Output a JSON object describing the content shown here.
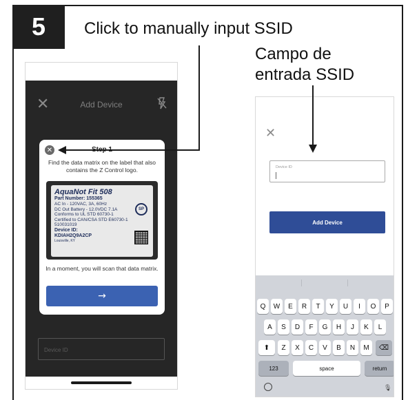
{
  "step_number": "5",
  "top_caption": "Click to manually input SSID",
  "right_caption": {
    "line1": "Campo de",
    "line2": "entrada SSID"
  },
  "left_phone": {
    "header_title": "Add Device",
    "close_glyph": "✕",
    "flash_icon": "flash-off-icon",
    "modal": {
      "close_glyph": "✕",
      "title": "Step 1",
      "instruction": "Find the data matrix on the label that also contains the Z Control logo.",
      "label": {
        "brand": "AquaNot Fit 508",
        "part_number": "Part Number: 155365",
        "line1": "AC In - 120VAC, 3A, 60Hz",
        "line2": "DC Out Battery - 12.0VDC 7.1A",
        "line3": "Conforms to UL STD 60730-1",
        "line4": "Certified to CAN/CSA STD E60730-1",
        "line5": "510031019",
        "device_id_label": "Device ID:",
        "device_id": "KDIAH2Q9A2CP",
        "location": "Louisville, KY",
        "csa": "SP"
      },
      "note": "In a moment, you will scan that data matrix.",
      "next_glyph": "→"
    },
    "field_placeholder": "Device ID"
  },
  "right_phone": {
    "close_glyph": "✕",
    "field_label": "Device ID",
    "button_label": "Add Device",
    "keyboard": {
      "row1": [
        "Q",
        "W",
        "E",
        "R",
        "T",
        "Y",
        "U",
        "I",
        "O",
        "P"
      ],
      "row2": [
        "A",
        "S",
        "D",
        "F",
        "G",
        "H",
        "J",
        "K",
        "L"
      ],
      "row3": [
        "Z",
        "X",
        "C",
        "V",
        "B",
        "N",
        "M"
      ],
      "shift_glyph": "⬆",
      "backspace_glyph": "⌫",
      "numbers_label": "123",
      "space_label": "space",
      "return_label": "return"
    }
  },
  "colors": {
    "primary_blue": "#3b62b2",
    "dark_blue": "#2f4d97",
    "badge": "#1f1f1f"
  }
}
